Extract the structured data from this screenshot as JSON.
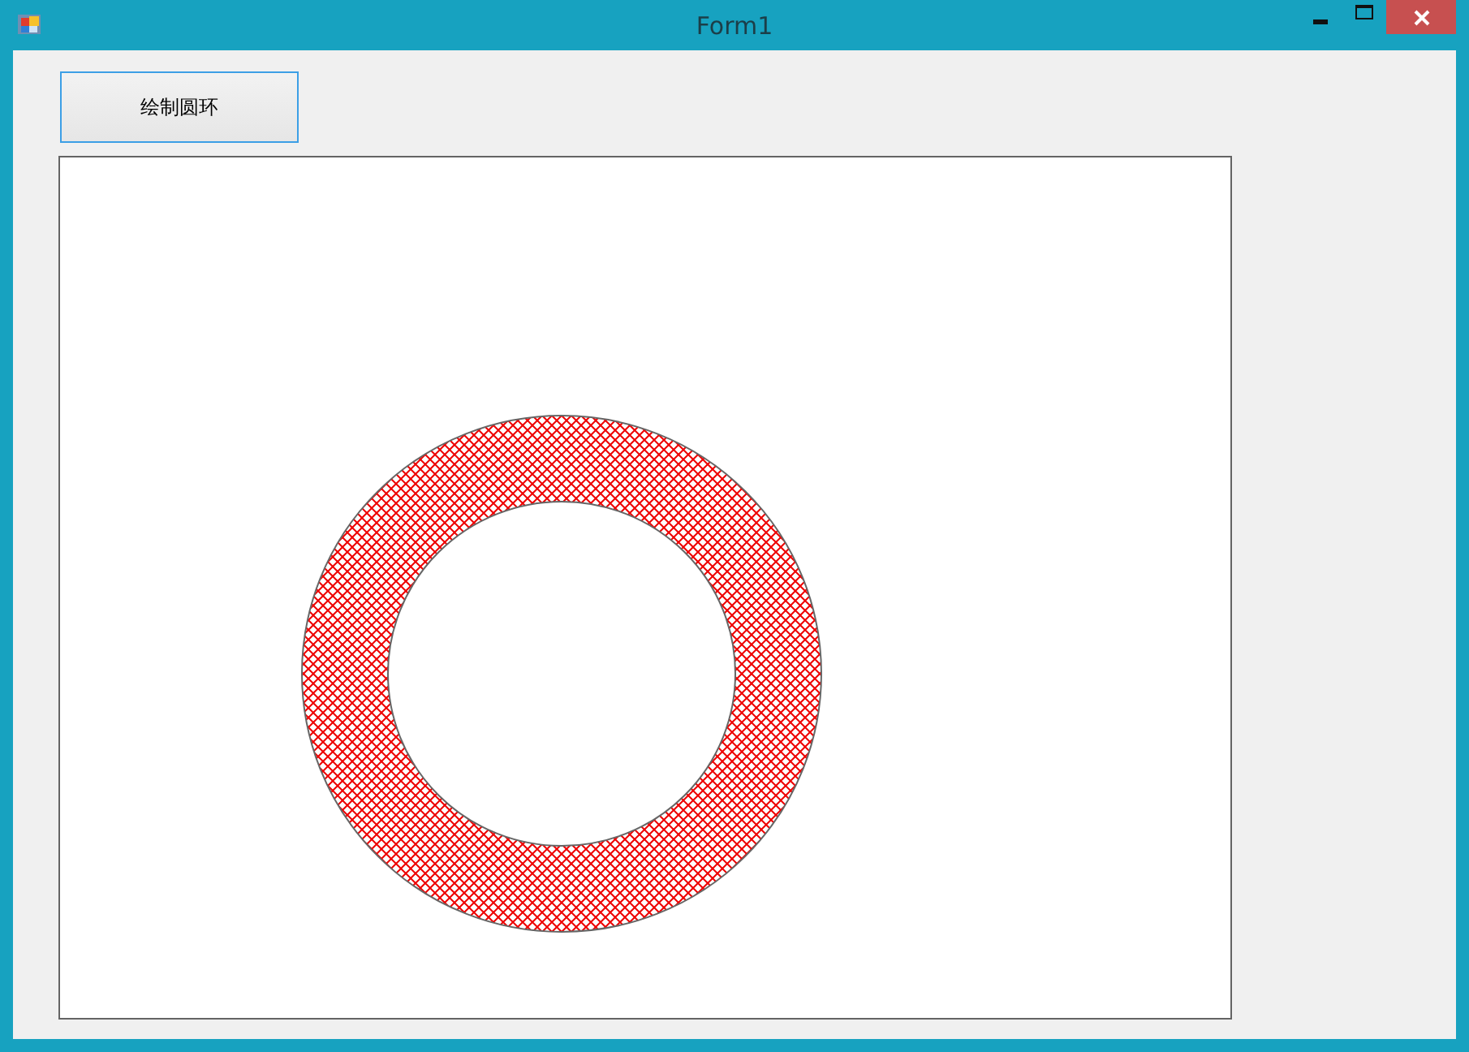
{
  "window": {
    "title": "Form1"
  },
  "button": {
    "label": "绘制圆环"
  }
}
